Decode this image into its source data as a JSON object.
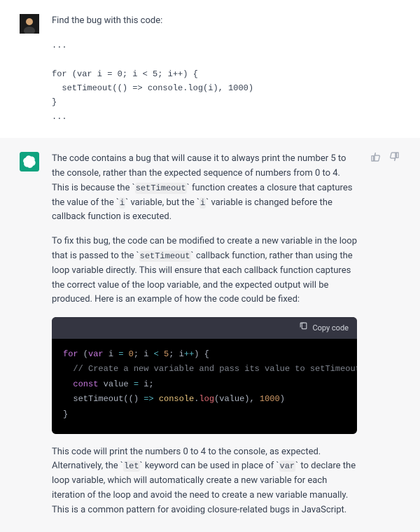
{
  "user": {
    "prompt_intro": "Find the bug with this code:",
    "code": "...\n\nfor (var i = 0; i < 5; i++) {\n  setTimeout(() => console.log(i), 1000)\n}\n..."
  },
  "assistant": {
    "p1_a": "The code contains a bug that will cause it to always print the number 5 to the console, rather than the expected sequence of numbers from 0 to 4. This is because the ",
    "code1": "setTimeout",
    "p1_b": " function creates a closure that captures the value of the ",
    "code2": "i",
    "p1_c": " variable, but the ",
    "code3": "i",
    "p1_d": " variable is changed before the callback function is executed.",
    "p2_a": "To fix this bug, the code can be modified to create a new variable in the loop that is passed to the ",
    "code4": "setTimeout",
    "p2_b": " callback function, rather than using the loop variable directly. This will ensure that each callback function captures the correct value of the loop variable, and the expected output will be produced. Here is an example of how the code could be fixed:",
    "copy_label": "Copy code",
    "fix_code": {
      "l1_for": "for",
      "l1_open": " (",
      "l1_var": "var",
      "l1_i": " i ",
      "l1_eq": "=",
      "l1_zero": " 0",
      "l1_semi1": "; i ",
      "l1_lt": "<",
      "l1_five": " 5",
      "l1_semi2": "; i",
      "l1_pp": "++",
      "l1_close": ") {",
      "l2": "  // Create a new variable and pass its value to setTimeout",
      "l3_const": "  const",
      "l3_value": " value ",
      "l3_eq": "=",
      "l3_i": " i;",
      "l4_a": "  setTimeout(() ",
      "l4_arrow": "=>",
      "l4_b": " ",
      "l4_console": "console",
      "l4_dot": ".",
      "l4_log": "log",
      "l4_open": "(value), ",
      "l4_num": "1000",
      "l4_close": ")",
      "l5": "}"
    },
    "p3_a": "This code will print the numbers 0 to 4 to the console, as expected. Alternatively, the ",
    "code5": "let",
    "p3_b": " keyword can be used in place of ",
    "code6": "var",
    "p3_c": " to declare the loop variable, which will automatically create a new variable for each iteration of the loop and avoid the need to create a new variable manually. This is a common pattern for avoiding closure-related bugs in JavaScript."
  }
}
